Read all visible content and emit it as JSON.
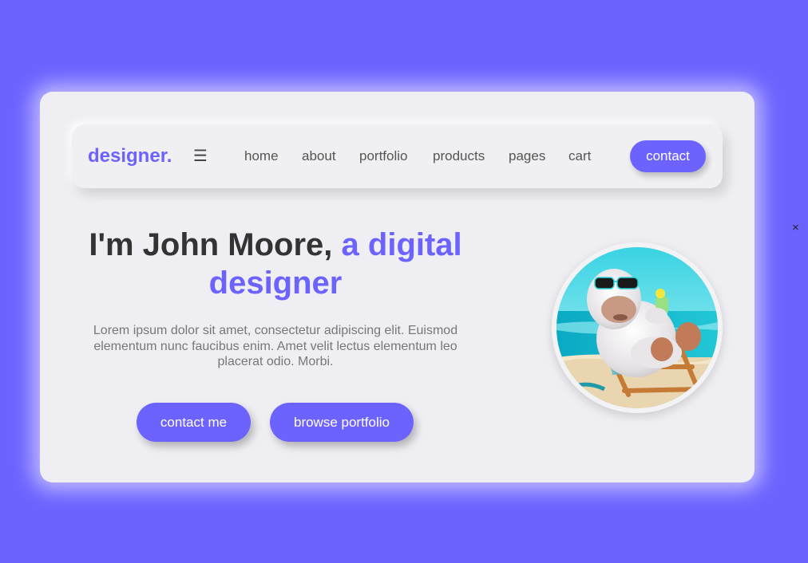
{
  "colors": {
    "accent": "#6c63ff",
    "card": "#efeff3",
    "text_dark": "#333333",
    "text_muted": "#777777"
  },
  "close_icon": "×",
  "nav": {
    "logo": "designer.",
    "menu_icon": "☰",
    "links": [
      "home",
      "about",
      "portfolio",
      "products",
      "pages",
      "cart"
    ],
    "contact_label": "contact"
  },
  "hero": {
    "title_main": "I'm John Moore, ",
    "title_accent": "a digital designer",
    "description": "Lorem ipsum dolor sit amet, consectetur adipiscing elit. Euismod elementum nunc faucibus enim. Amet velit lectus elementum leo placerat odio. Morbi.",
    "buttons": {
      "contact_me": "contact me",
      "browse_portfolio": "browse portfolio"
    }
  },
  "avatar": {
    "icon": "gorilla-on-beach-chair-avatar"
  }
}
